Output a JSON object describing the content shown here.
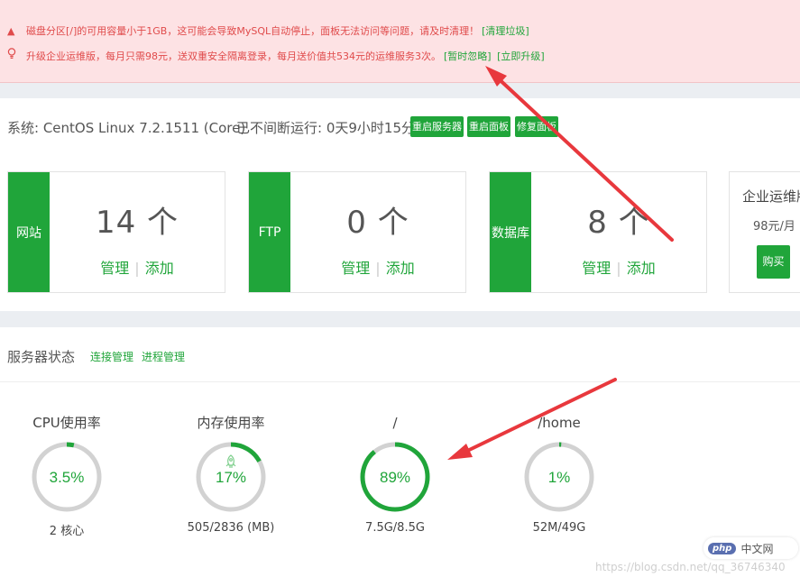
{
  "alerts": {
    "disk_warning": "磁盘分区[/]的可用容量小于1GB，这可能会导致MySQL自动停止，面板无法访问等问题，请及时清理！",
    "disk_action": "[清理垃圾]",
    "upgrade_msg": "升级企业运维版，每月只需98元，送双重安全隔离登录，每月送价值共534元的运维服务3次。",
    "ignore_action": "[暂时忽略]",
    "upgrade_action": "[立即升级]"
  },
  "system": {
    "os": "系统: CentOS Linux 7.2.1511 (Core)",
    "uptime": "已不间断运行: 0天9小时15分钟",
    "buttons": [
      "重启服务器",
      "重启面板",
      "修复面板"
    ]
  },
  "cards": [
    {
      "label": "网站",
      "count": "14 个",
      "manage": "管理",
      "add": "添加"
    },
    {
      "label": "FTP",
      "count": "0 个",
      "manage": "管理",
      "add": "添加"
    },
    {
      "label": "数据库",
      "count": "8 个",
      "manage": "管理",
      "add": "添加"
    }
  ],
  "ad": {
    "title": "企业运维版",
    "price": "98元/月",
    "buy": "购买"
  },
  "status": {
    "title": "服务器状态",
    "links": [
      "连接管理",
      "进程管理"
    ],
    "gauges": [
      {
        "title": "CPU使用率",
        "value": "3.5%",
        "percent": 3.5,
        "footer": "2 核心"
      },
      {
        "title": "内存使用率",
        "value": "17%",
        "percent": 17,
        "footer": "505/2836 (MB)"
      },
      {
        "title": "/",
        "value": "89%",
        "percent": 89,
        "footer": "7.5G/8.5G"
      },
      {
        "title": "/home",
        "value": "1%",
        "percent": 1,
        "footer": "52M/49G"
      }
    ]
  },
  "branding": {
    "php_logo": "php",
    "php_site": "中文网",
    "watermark": "https://blog.csdn.net/qq_36746340"
  },
  "colors": {
    "accent": "#20a53a",
    "alert_text": "#e04b4b",
    "alert_bg": "#fde2e4",
    "annotation_arrow": "#e8383d"
  },
  "icons": {
    "alert": "warning-triangle-icon",
    "upgrade": "lightbulb-icon",
    "memory": "rocket-icon"
  }
}
